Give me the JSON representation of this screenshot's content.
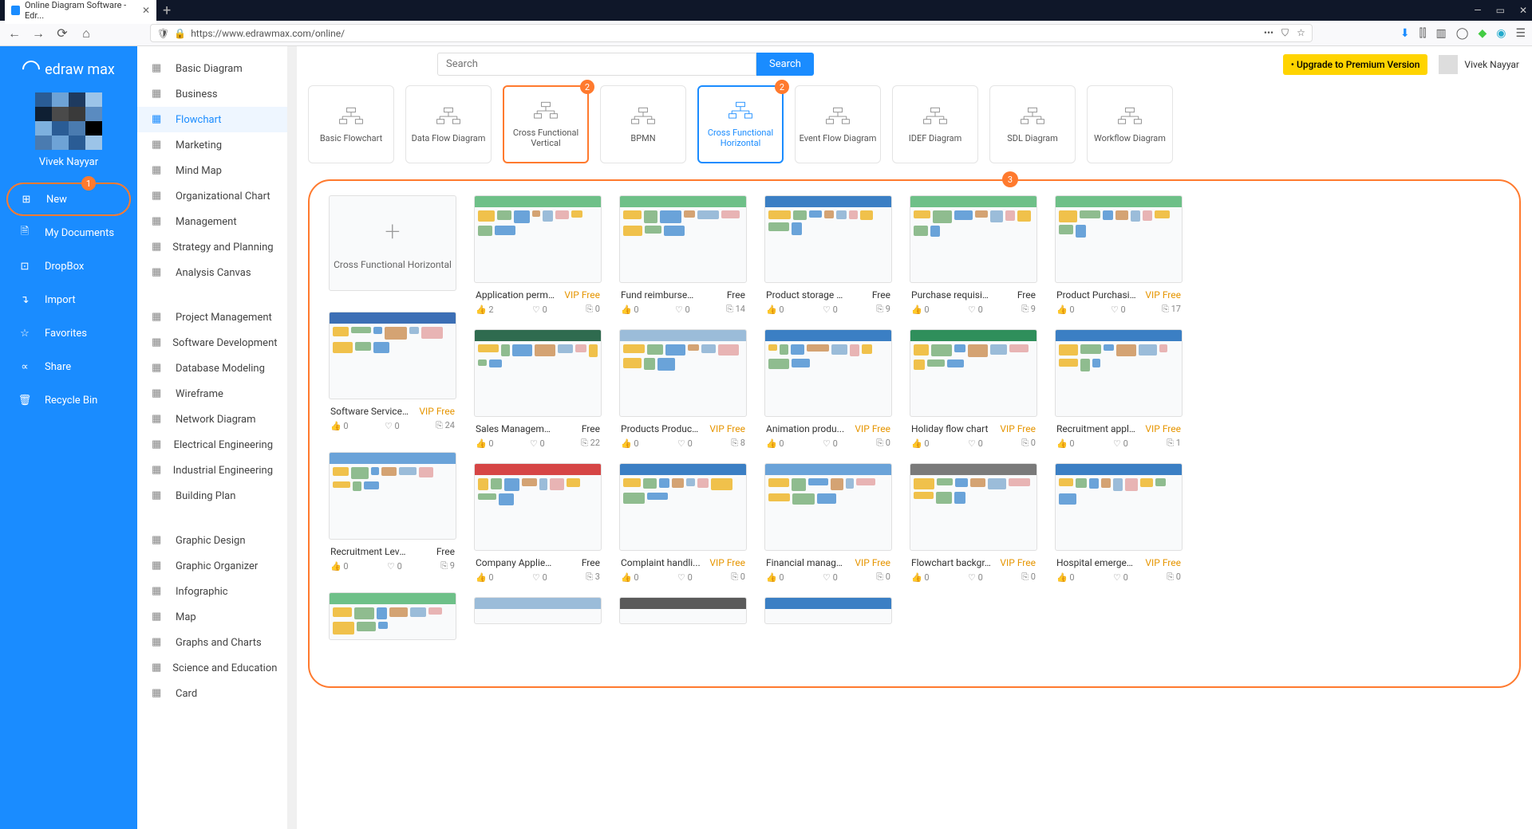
{
  "browser": {
    "tab_title": "Online Diagram Software - Edr...",
    "url": "https://www.edrawmax.com/online/"
  },
  "app": {
    "logo_text": "edraw max",
    "username": "Vivek Nayyar",
    "side_items": [
      {
        "label": "New",
        "badge": "1",
        "active": true
      },
      {
        "label": "My Documents"
      },
      {
        "label": "DropBox"
      },
      {
        "label": "Import"
      },
      {
        "label": "Favorites"
      },
      {
        "label": "Share"
      },
      {
        "label": "Recycle Bin"
      }
    ],
    "categories_a": [
      "Basic Diagram",
      "Business",
      "Flowchart",
      "Marketing",
      "Mind Map",
      "Organizational Chart",
      "Management",
      "Strategy and Planning",
      "Analysis Canvas"
    ],
    "categories_b": [
      "Project Management",
      "Software Development",
      "Database Modeling",
      "Wireframe",
      "Network Diagram",
      "Electrical Engineering",
      "Industrial Engineering",
      "Building Plan"
    ],
    "categories_c": [
      "Graphic Design",
      "Graphic Organizer",
      "Infographic",
      "Map",
      "Graphs and Charts",
      "Science and Education",
      "Card"
    ],
    "active_category": "Flowchart",
    "search_placeholder": "Search",
    "search_button": "Search",
    "upgrade_text": "• Upgrade to Premium Version",
    "top_user": "Vivek Nayyar"
  },
  "types": [
    {
      "label": "Basic Flowchart"
    },
    {
      "label": "Data Flow Diagram"
    },
    {
      "label": "Cross Functional Vertical",
      "sel": "orange",
      "badge": "2"
    },
    {
      "label": "BPMN"
    },
    {
      "label": "Cross Functional Horizontal",
      "sel": "blue",
      "badge": "2"
    },
    {
      "label": "Event Flow Diagram"
    },
    {
      "label": "IDEF Diagram"
    },
    {
      "label": "SDL Diagram"
    },
    {
      "label": "Workflow Diagram"
    }
  ],
  "blank_tile_label": "Cross Functional Horizontal",
  "wrap_badge": "3",
  "col1": [
    {
      "name": "Software Service ...",
      "tag": "VIP Free",
      "like": "0",
      "heart": "0",
      "copy": "24",
      "hdr": "#3c6fb5"
    },
    {
      "name": "Recruitment Level Cr...",
      "tag": "Free",
      "like": "0",
      "heart": "0",
      "copy": "9",
      "hdr": "#6aa3d9"
    }
  ],
  "rows": [
    [
      {
        "name": "Application permi...",
        "tag": "VIP Free",
        "like": "2",
        "heart": "0",
        "copy": "0",
        "hdr": "#6ec088"
      },
      {
        "name": "Fund reimbursement ...",
        "tag": "Free",
        "like": "0",
        "heart": "0",
        "copy": "14",
        "hdr": "#6ec088"
      },
      {
        "name": "Product storage flow ...",
        "tag": "Free",
        "like": "0",
        "heart": "0",
        "copy": "9",
        "hdr": "#3b7fc4"
      },
      {
        "name": "Purchase requisition ...",
        "tag": "Free",
        "like": "0",
        "heart": "0",
        "copy": "9",
        "hdr": "#6ec088"
      },
      {
        "name": "Product Purchasi...",
        "tag": "VIP Free",
        "like": "0",
        "heart": "0",
        "copy": "17",
        "hdr": "#6ec088"
      }
    ],
    [
      {
        "name": "Sales Management C...",
        "tag": "Free",
        "like": "0",
        "heart": "0",
        "copy": "22",
        "hdr": "#2f6b4f"
      },
      {
        "name": "Products Producti...",
        "tag": "VIP Free",
        "like": "0",
        "heart": "0",
        "copy": "8",
        "hdr": "#9bbcd9"
      },
      {
        "name": "Animation produ...",
        "tag": "VIP Free",
        "like": "0",
        "heart": "0",
        "copy": "0",
        "hdr": "#3b7fc4"
      },
      {
        "name": "Holiday flow chart",
        "tag": "VIP Free",
        "like": "0",
        "heart": "0",
        "copy": "0",
        "hdr": "#2f8f5b"
      },
      {
        "name": "Recruitment appli...",
        "tag": "VIP Free",
        "like": "0",
        "heart": "0",
        "copy": "1",
        "hdr": "#3b7fc4"
      }
    ],
    [
      {
        "name": "Company Applies To ...",
        "tag": "Free",
        "like": "0",
        "heart": "0",
        "copy": "3",
        "hdr": "#d64545"
      },
      {
        "name": "Complaint handli...",
        "tag": "VIP Free",
        "like": "0",
        "heart": "0",
        "copy": "0",
        "hdr": "#3b7fc4"
      },
      {
        "name": "Financial manage...",
        "tag": "VIP Free",
        "like": "0",
        "heart": "0",
        "copy": "0",
        "hdr": "#6aa3d9"
      },
      {
        "name": "Flowchart backgr...",
        "tag": "VIP Free",
        "like": "0",
        "heart": "0",
        "copy": "0",
        "hdr": "#7a7a7a"
      },
      {
        "name": "Hospital emergen...",
        "tag": "VIP Free",
        "like": "0",
        "heart": "0",
        "copy": "0",
        "hdr": "#3b7fc4"
      }
    ]
  ]
}
